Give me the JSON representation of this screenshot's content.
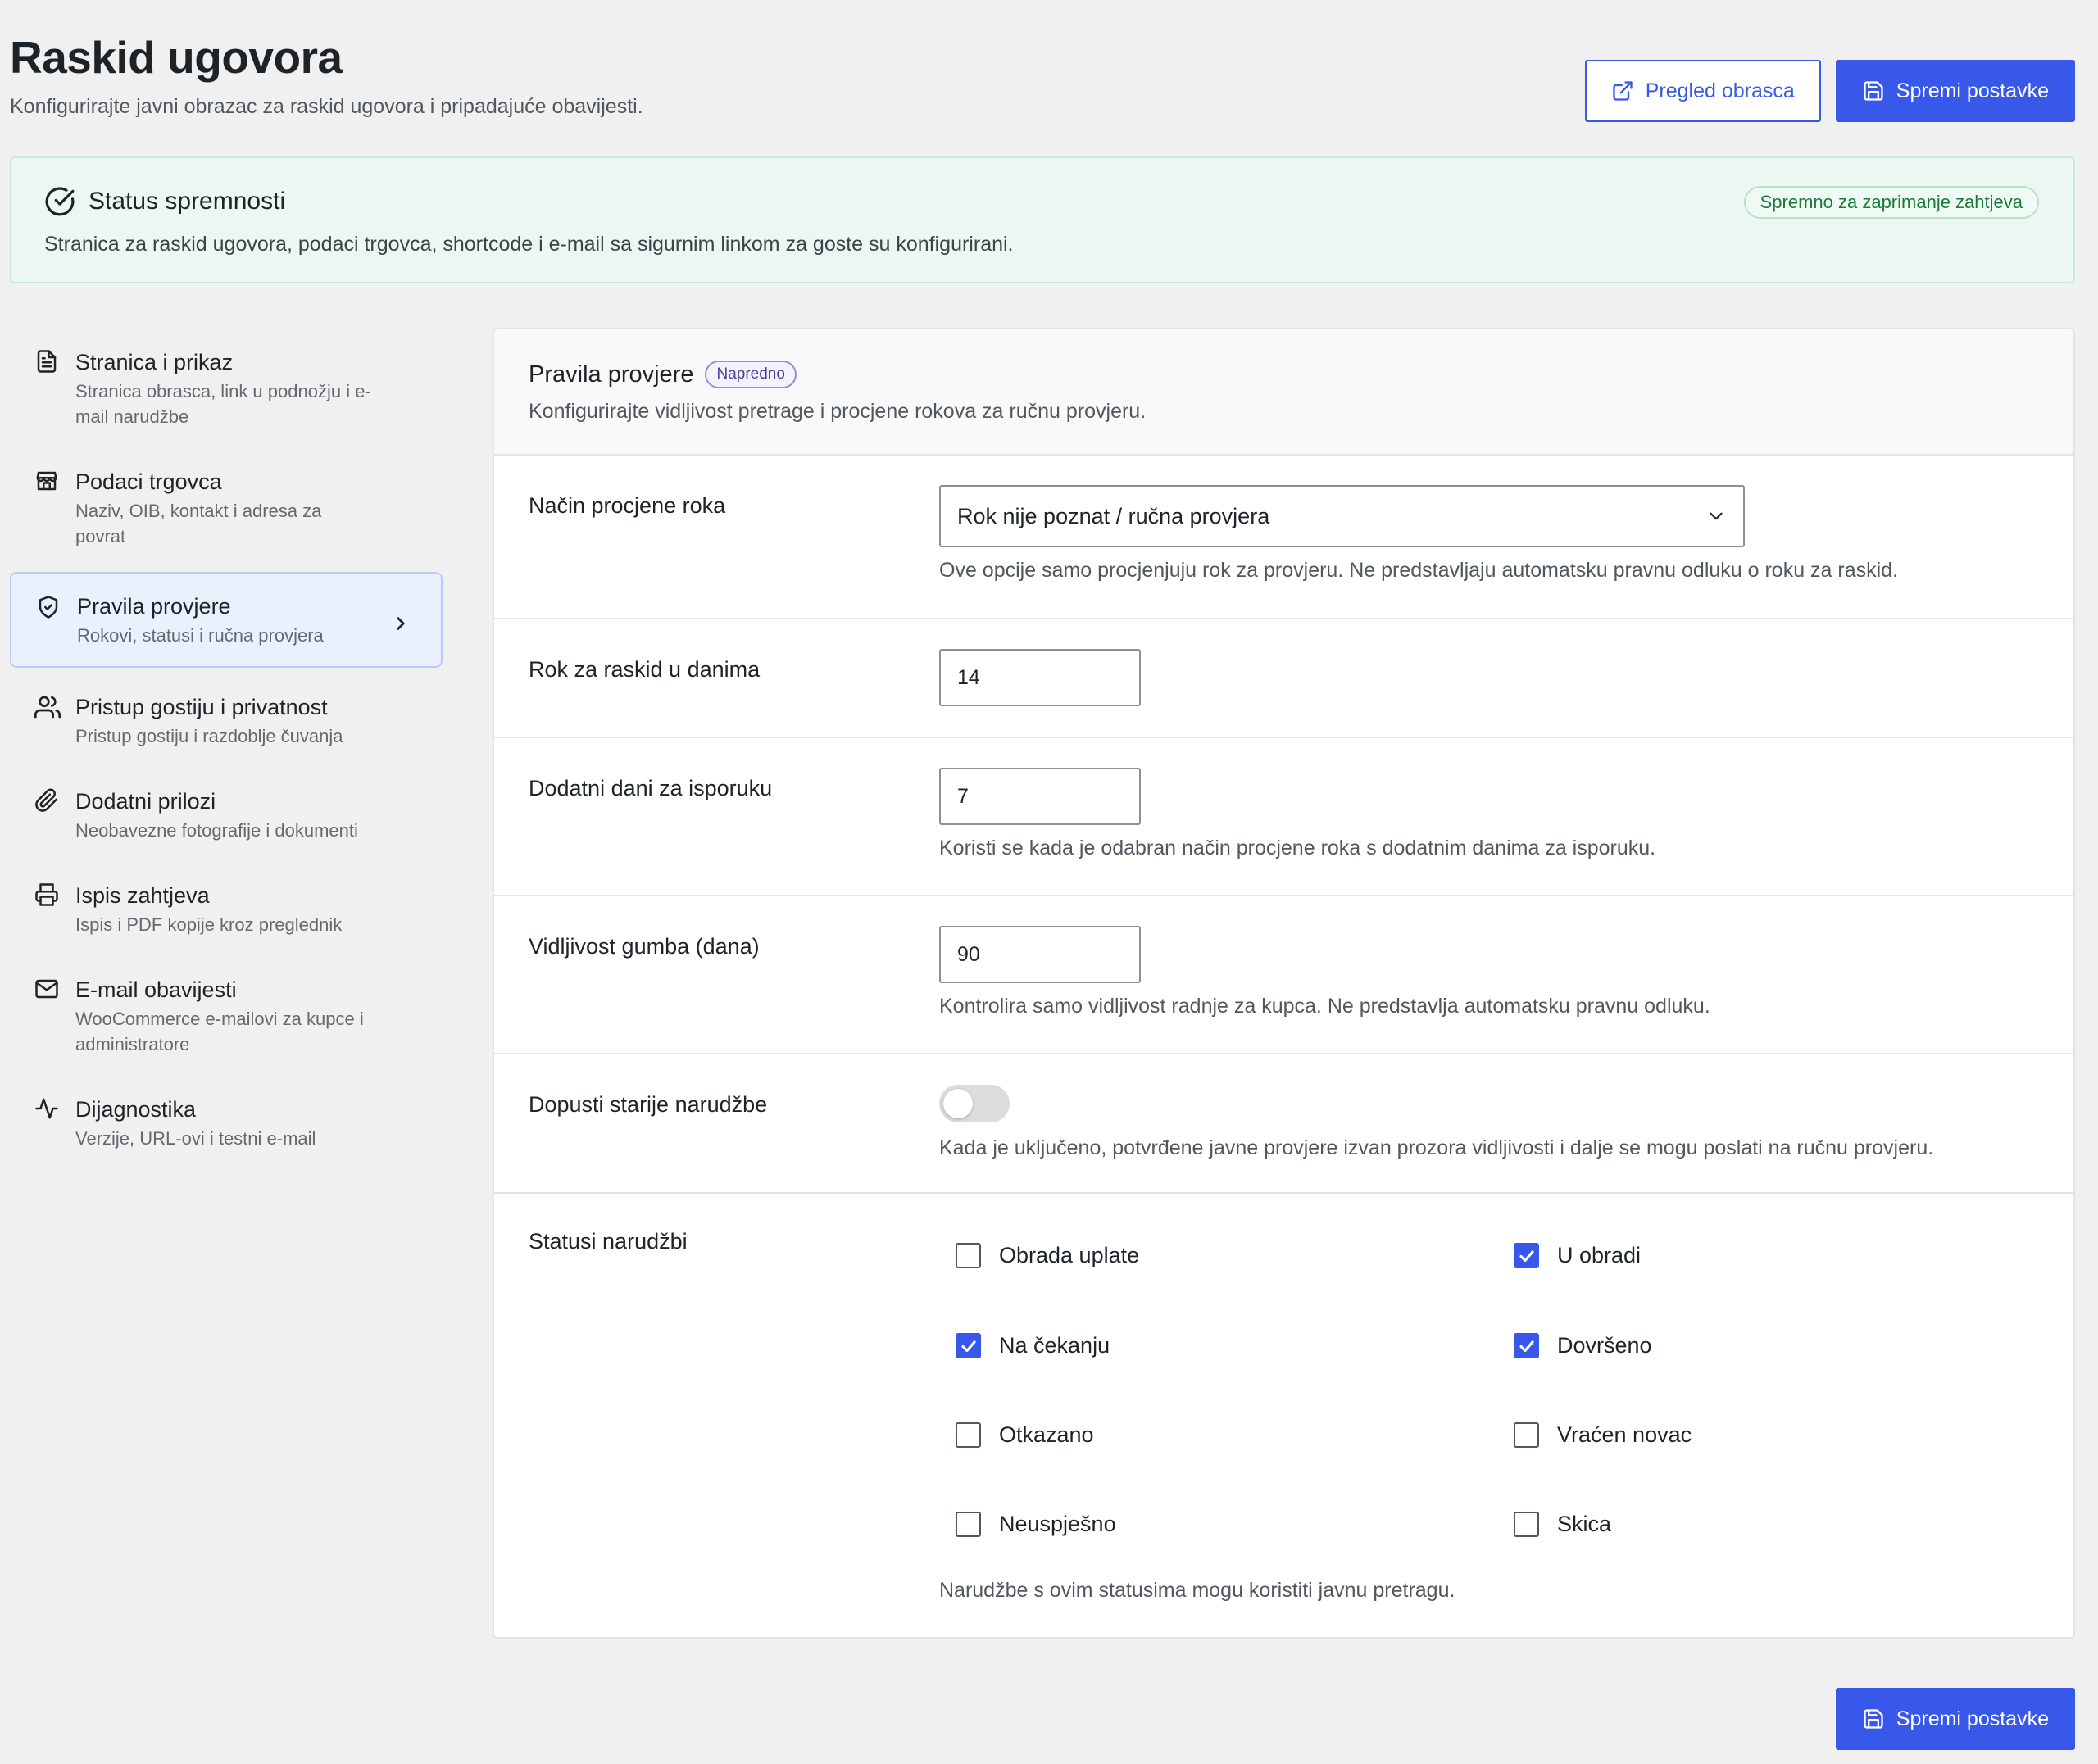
{
  "header": {
    "title": "Raskid ugovora",
    "subtitle": "Konfigurirajte javni obrazac za raskid ugovora i pripadajuće obavijesti.",
    "preview_button": "Pregled obrasca",
    "save_button": "Spremi postavke"
  },
  "status": {
    "title": "Status spremnosti",
    "text": "Stranica za raskid ugovora, podaci trgovca, shortcode i e-mail sa sigurnim linkom za goste su konfigurirani.",
    "badge": "Spremno za zaprimanje zahtjeva"
  },
  "sidebar": {
    "items": [
      {
        "icon": "document-icon",
        "title": "Stranica i prikaz",
        "desc": "Stranica obrasca, link u podnožju i e-mail narudžbe",
        "active": false
      },
      {
        "icon": "store-icon",
        "title": "Podaci trgovca",
        "desc": "Naziv, OIB, kontakt i adresa za povrat",
        "active": false
      },
      {
        "icon": "shield-icon",
        "title": "Pravila provjere",
        "desc": "Rokovi, statusi i ručna provjera",
        "active": true
      },
      {
        "icon": "users-icon",
        "title": "Pristup gostiju i privatnost",
        "desc": "Pristup gostiju i razdoblje čuvanja",
        "active": false
      },
      {
        "icon": "paperclip-icon",
        "title": "Dodatni prilozi",
        "desc": "Neobavezne fotografije i dokumenti",
        "active": false
      },
      {
        "icon": "printer-icon",
        "title": "Ispis zahtjeva",
        "desc": "Ispis i PDF kopije kroz preglednik",
        "active": false
      },
      {
        "icon": "mail-icon",
        "title": "E-mail obavijesti",
        "desc": "WooCommerce e-mailovi za kupce i administratore",
        "active": false
      },
      {
        "icon": "activity-icon",
        "title": "Dijagnostika",
        "desc": "Verzije, URL-ovi i testni e-mail",
        "active": false
      }
    ]
  },
  "panel": {
    "title": "Pravila provjere",
    "badge": "Napredno",
    "desc": "Konfigurirajte vidljivost pretrage i procjene rokova za ručnu provjeru.",
    "deadline_mode": {
      "label": "Način procjene roka",
      "value": "Rok nije poznat / ručna provjera",
      "help": "Ove opcije samo procjenjuju rok za provjeru. Ne predstavljaju automatsku pravnu odluku o roku za raskid."
    },
    "days": {
      "label": "Rok za raskid u danima",
      "value": "14"
    },
    "delivery_days": {
      "label": "Dodatni dani za isporuku",
      "value": "7",
      "help": "Koristi se kada je odabran način procjene roka s dodatnim danima za isporuku."
    },
    "visibility": {
      "label": "Vidljivost gumba (dana)",
      "value": "90",
      "help": "Kontrolira samo vidljivost radnje za kupca. Ne predstavlja automatsku pravnu odluku."
    },
    "allow_old": {
      "label": "Dopusti starije narudžbe",
      "enabled": false,
      "help": "Kada je uključeno, potvrđene javne provjere izvan prozora vidljivosti i dalje se mogu poslati na ručnu provjeru."
    },
    "statuses": {
      "label": "Statusi narudžbi",
      "items": [
        {
          "label": "Obrada uplate",
          "checked": false
        },
        {
          "label": "U obradi",
          "checked": true
        },
        {
          "label": "Na čekanju",
          "checked": true
        },
        {
          "label": "Dovršeno",
          "checked": true
        },
        {
          "label": "Otkazano",
          "checked": false
        },
        {
          "label": "Vraćen novac",
          "checked": false
        },
        {
          "label": "Neuspješno",
          "checked": false
        },
        {
          "label": "Skica",
          "checked": false
        }
      ],
      "help": "Narudžbe s ovim statusima mogu koristiti javnu pretragu."
    }
  },
  "footer": {
    "save_button": "Spremi postavke"
  },
  "colors": {
    "accent": "#3858e9",
    "success_bg": "#edf7f1",
    "success_text": "#1a7a3a",
    "active_nav_bg": "#eaf1fd"
  }
}
